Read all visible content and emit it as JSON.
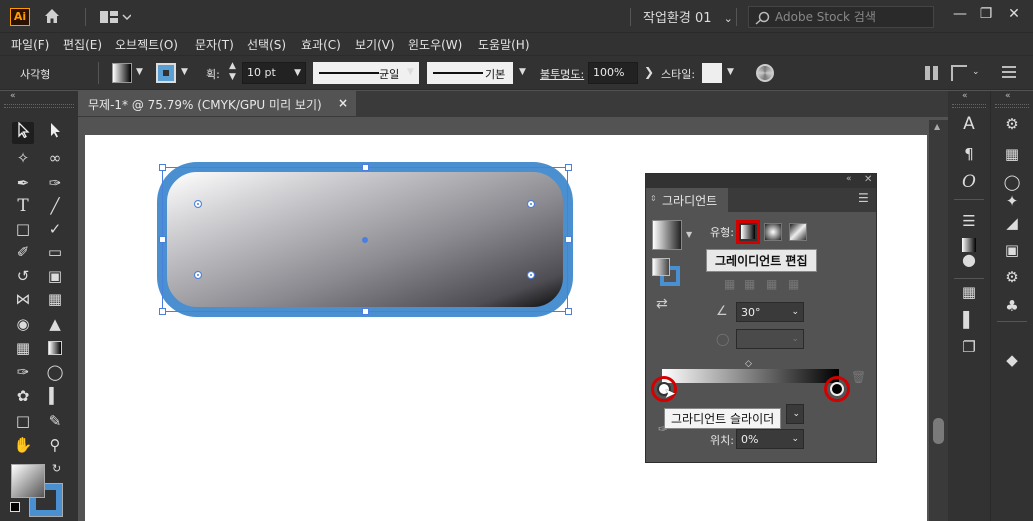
{
  "app": {
    "logo": "Ai",
    "workspace_label": "작업환경 01",
    "stock_search_placeholder": "Adobe Stock 검색"
  },
  "menu": [
    "파일(F)",
    "편집(E)",
    "오브젝트(O)",
    "문자(T)",
    "선택(S)",
    "효과(C)",
    "보기(V)",
    "윈도우(W)",
    "도움말(H)"
  ],
  "control": {
    "object_type": "사각형",
    "stroke_label": "획:",
    "stroke_weight": "10 pt",
    "profile_label": "균일",
    "brush_label": "기본",
    "opacity_label": "불투명도:",
    "opacity_value": "100%",
    "style_label": "스타일:"
  },
  "document": {
    "tab_title": "무제-1* @ 75.79% (CMYK/GPU 미리 보기)",
    "close": "×"
  },
  "gradient_panel": {
    "title": "그라디언트",
    "type_label": "유형:",
    "edit_tooltip": "그레이디언트 편집",
    "angle_value": "30°",
    "slider_tooltip": "그라디언트 슬라이더",
    "location_label": "위치:",
    "location_value": "0%"
  },
  "colors": {
    "accent_blue": "#4a8fcf",
    "highlight_red": "#d40000",
    "chrome": "#323232",
    "workspace_bg": "#535353"
  }
}
